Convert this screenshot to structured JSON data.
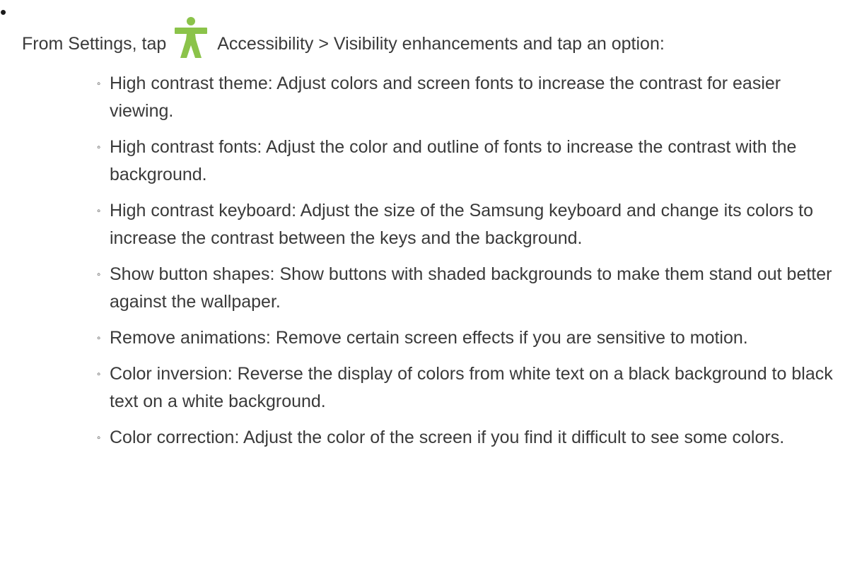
{
  "intro": {
    "before_icon": "From Settings, tap",
    "after_icon": "Accessibility > Visibility enhancements and tap an option:",
    "icon": "accessibility-person-icon",
    "icon_color": "#8bc34a"
  },
  "bullet_char": "•",
  "sub_bullet_char": "◦",
  "options": [
    "High contrast theme: Adjust colors and screen fonts to increase the contrast for easier viewing.",
    "High contrast fonts: Adjust the color and outline of fonts to increase the contrast with the background.",
    "High contrast keyboard: Adjust the size of the Samsung keyboard and change its colors to increase the contrast between the keys and the background.",
    "Show button shapes: Show buttons with shaded backgrounds to make them stand out better against the wallpaper.",
    "Remove animations: Remove certain screen effects if you are sensitive to motion.",
    "Color inversion: Reverse the display of colors from white text on a black background to black text on a white background.",
    "Color correction: Adjust the color of the screen if you find it difficult to see some colors."
  ]
}
